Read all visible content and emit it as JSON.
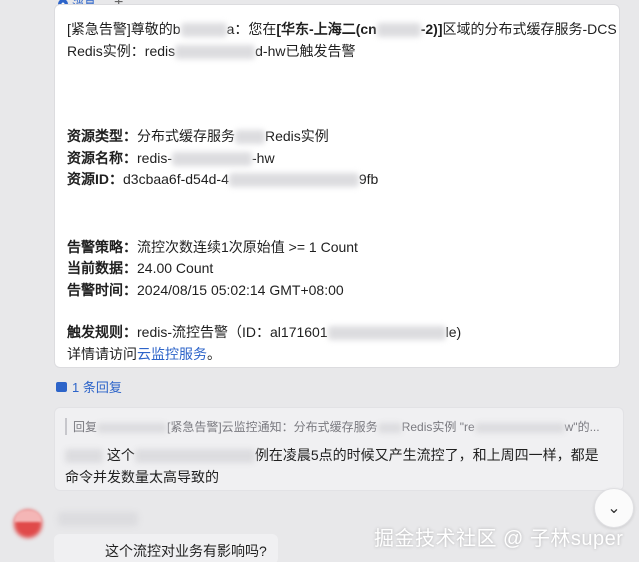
{
  "tabs": {
    "message_label": "消息",
    "add_symbol": "+"
  },
  "alert": {
    "line1_prefix": "[紧急告警]",
    "line1_greet_a": "尊敬的b",
    "line1_greet_b": "a：您在",
    "line1_region_a": "[华东-上海二(cn",
    "line1_region_b": "-2)]",
    "line1_suffix": "区域的分布式缓存服务-DCS",
    "line2_a": "Redis实例：redis",
    "line2_b": "d-hw已触发告警",
    "resource_type_label": "资源类型：",
    "resource_type_a": "分布式缓存服务",
    "resource_type_b": "Redis实例",
    "resource_name_label": "资源名称：",
    "resource_name_a": "redis-",
    "resource_name_b": "-hw",
    "resource_id_label": "资源ID：",
    "resource_id_a": "d3cbaa6f-d54d-4",
    "resource_id_b": "9fb",
    "policy_label": "告警策略：",
    "policy_value": "流控次数连续1次原始值 >= 1 Count",
    "current_label": "当前数据：",
    "current_value": "24.00 Count",
    "time_label": "告警时间：",
    "time_value": "2024/08/15 05:02:14 GMT+08:00",
    "rule_label": "触发规则：",
    "rule_a": "redis-流控告警（ID：al171601",
    "rule_b": "le)",
    "detail_prefix": "详情请访问",
    "detail_link": "云监控服务",
    "detail_suffix": "。"
  },
  "replies": {
    "count_label": "1 条回复",
    "quote_a": "回复",
    "quote_b": "[紧急告警]云监控通知：分布式缓存服务",
    "quote_c": "Redis实例 \"re",
    "quote_d": "w\"的...",
    "text_a": "这个",
    "text_b": "例在凌晨5点的时候又产生流控了，和上周四一样，都是",
    "text_c": "命令并发数量太高导致的",
    "next_message": "这个流控对业务有影响吗?"
  },
  "expand_icon": "chevron-double-down",
  "watermark": "掘金技术社区 @ 子林super",
  "colors": {
    "link": "#2d64c9",
    "card_bg": "#ffffff",
    "page_bg": "#e8e8ea"
  }
}
